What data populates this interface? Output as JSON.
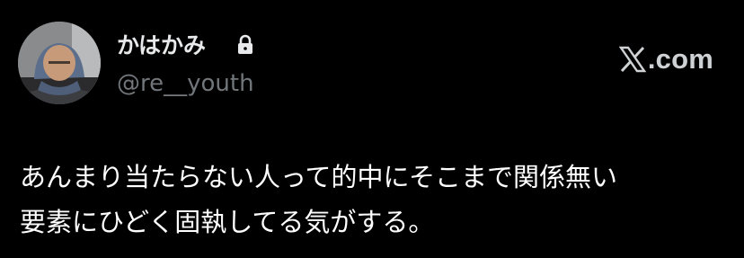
{
  "author": {
    "display_name": "かはかみ",
    "handle": "@re__youth",
    "avatar_icon": "profile-photo",
    "protected_icon": "lock-icon"
  },
  "brand": {
    "logo_icon": "x-logo-icon",
    "text": ".com"
  },
  "tweet": {
    "lines": [
      "あんまり当たらない人って的中にそこまで関係無い",
      "要素にひどく固執してる気がする。"
    ]
  },
  "colors": {
    "background": "#000000",
    "primary_text": "#e7e9ea",
    "secondary_text": "#71767b"
  }
}
